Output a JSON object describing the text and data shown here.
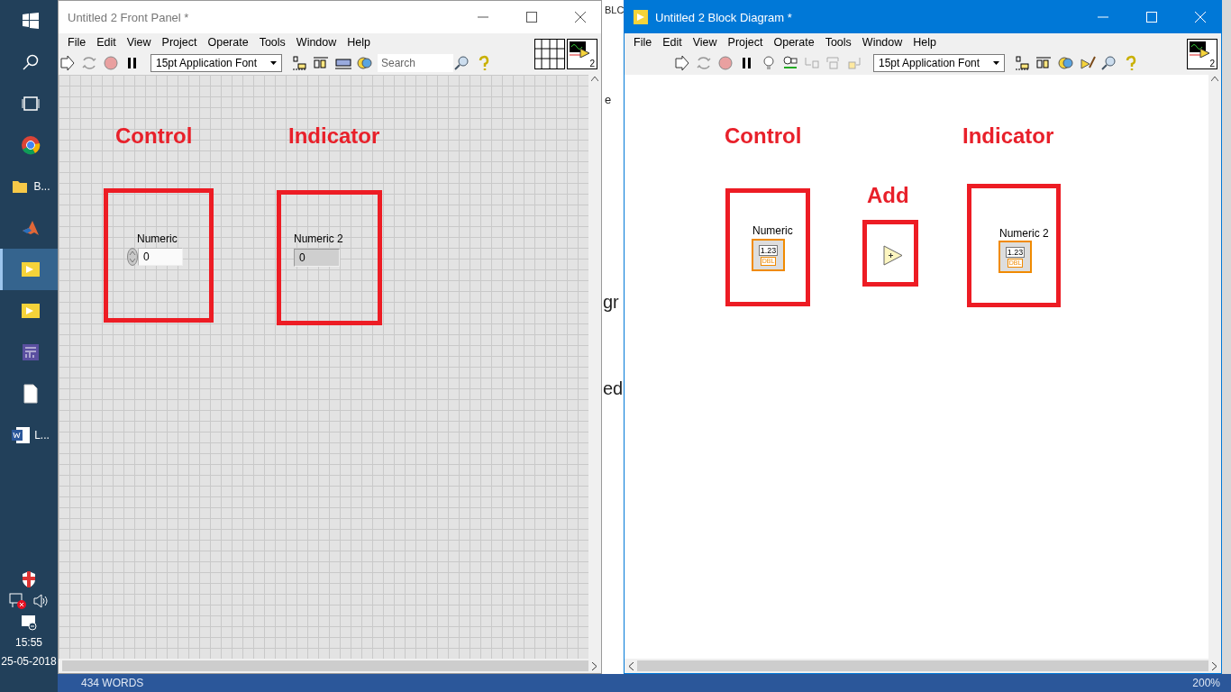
{
  "taskbar": {
    "apps": [
      {
        "kind": "chrome",
        "selected": false
      },
      {
        "kind": "folder",
        "label": "B...",
        "selected": false
      },
      {
        "kind": "matlab",
        "selected": false
      },
      {
        "kind": "labview",
        "selected": true
      },
      {
        "kind": "labview",
        "selected": false
      },
      {
        "kind": "monitor",
        "selected": false
      },
      {
        "kind": "file",
        "selected": false
      },
      {
        "kind": "word",
        "label": "L...",
        "selected": false
      }
    ],
    "clock": {
      "time": "15:55",
      "date": "25-05-2018"
    }
  },
  "document": {
    "fragments": [
      "BLC",
      "e",
      "gr",
      "ed"
    ],
    "status_bar": [
      "434 WORDS",
      "200%"
    ]
  },
  "front_panel": {
    "title": "Untitled 2 Front Panel *",
    "focused": false,
    "menu": [
      "File",
      "Edit",
      "View",
      "Project",
      "Operate",
      "Tools",
      "Window",
      "Help"
    ],
    "font_select": "15pt Application Font",
    "search": {
      "placeholder": "Search"
    },
    "vi_icon_label": "2",
    "annotations": [
      "Control",
      "Indicator"
    ],
    "controls": [
      {
        "kind": "control",
        "label": "Numeric",
        "value": "0"
      },
      {
        "kind": "indicator",
        "label": "Numeric 2",
        "value": "0"
      }
    ]
  },
  "block_diagram": {
    "title": "Untitled 2 Block Diagram *",
    "focused": true,
    "menu": [
      "File",
      "Edit",
      "View",
      "Project",
      "Operate",
      "Tools",
      "Window",
      "Help"
    ],
    "font_select": "15pt Application Font",
    "vi_icon_label": "2",
    "annotations": [
      "Control",
      "Add",
      "Indicator"
    ],
    "nodes": [
      {
        "kind": "control",
        "label": "Numeric",
        "value": "1.23",
        "type": "DBL"
      },
      {
        "kind": "add"
      },
      {
        "kind": "indicator",
        "label": "Numeric 2",
        "value": "1.23",
        "type": "DBL"
      }
    ]
  }
}
